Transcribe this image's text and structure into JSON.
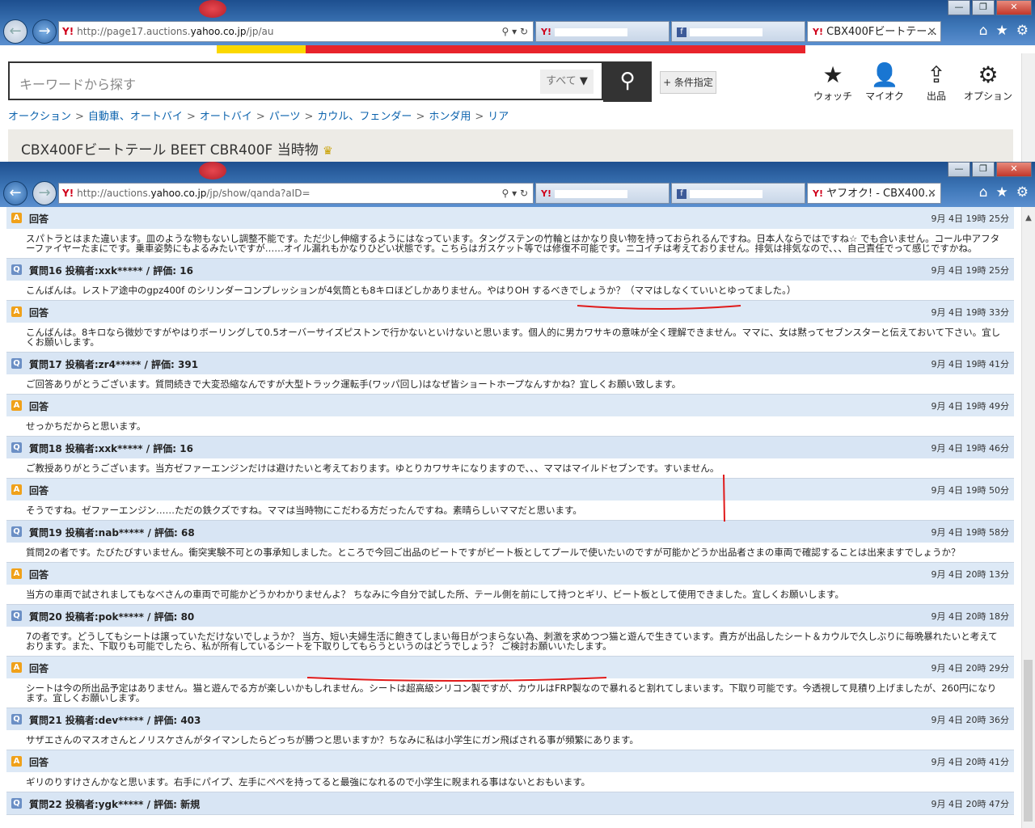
{
  "window1": {
    "url_host": "http://page17.auctions.",
    "url_domain": "yahoo.co.jp",
    "url_path": "/jp/au",
    "tab_active_title": "CBX400Fビートテー..."
  },
  "window2": {
    "url_host": "http://auctions.",
    "url_domain": "yahoo.co.jp",
    "url_path": "/jp/show/qanda?aID=",
    "tab_active_title": "ヤフオク! - CBX400..."
  },
  "search": {
    "placeholder": "キーワードから探す",
    "category": "すべて",
    "condition_button": "+ 条件指定"
  },
  "tools": [
    {
      "label": "ウォッチ",
      "icon": "star-icon"
    },
    {
      "label": "マイオク",
      "icon": "person-icon"
    },
    {
      "label": "出品",
      "icon": "upload-icon"
    },
    {
      "label": "オプション",
      "icon": "gear-icon"
    }
  ],
  "breadcrumb": [
    "オークション",
    "自動車、オートバイ",
    "オートバイ",
    "パーツ",
    "カウル、フェンダー",
    "ホンダ用",
    "リア"
  ],
  "item_title": "CBX400Fビートテール BEET CBR400F 当時物",
  "qa": [
    {
      "type": "a",
      "label": "回答",
      "time": "9月 4日 19時 25分",
      "text": "スパトラとはまた違います。皿のような物もないし調整不能です。ただ少し伸縮するようにはなっています。タングステンの竹輪とはかなり良い物を持っておられるんですね。日本人ならではですね☆ でも合いません。コール中アフターファイヤーたまにです。乗車姿勢にもよるみたいですが……オイル漏れもかなりひどい状態です。こちらはガスケット等では修復不可能です。ニコイチは考えておりません。排気は排気なので、、、自己責任でって感じですかね。"
    },
    {
      "type": "q",
      "label": "質問16 投稿者:xxk***** / 評価: 16",
      "time": "9月 4日 19時 25分",
      "text": "こんばんは。レストア途中のgpz400f のシリンダーコンプレッションが4気筒とも8キロほどしかありません。やはりOH するべきでしょうか？（ママはしなくていいとゆってました。）"
    },
    {
      "type": "a",
      "label": "回答",
      "time": "9月 4日 19時 33分",
      "text": "こんばんは。8キロなら微妙ですがやはりボーリングして0.5オーバーサイズピストンで行かないといけないと思います。個人的に男カワサキの意味が全く理解できません。ママに、女は黙ってセブンスターと伝えておいて下さい。宜しくお願いします。"
    },
    {
      "type": "q",
      "label": "質問17 投稿者:zr4***** / 評価: 391",
      "time": "9月 4日 19時 41分",
      "text": "ご回答ありがとうございます。質問続きで大変恐縮なんですが大型トラック運転手(ワッパ回し)はなぜ皆ショートホープなんすかね？宜しくお願い致します。"
    },
    {
      "type": "a",
      "label": "回答",
      "time": "9月 4日 19時 49分",
      "text": "せっかちだからと思います。"
    },
    {
      "type": "q",
      "label": "質問18 投稿者:xxk***** / 評価: 16",
      "time": "9月 4日 19時 46分",
      "text": "ご教授ありがとうございます。当方ゼファーエンジンだけは避けたいと考えております。ゆとりカワサキになりますので、、、ママはマイルドセブンです。すいません。"
    },
    {
      "type": "a",
      "label": "回答",
      "time": "9月 4日 19時 50分",
      "text": "そうですね。ゼファーエンジン……ただの鉄クズですね。ママは当時物にこだわる方だったんですね。素晴らしいママだと思います。"
    },
    {
      "type": "q",
      "label": "質問19 投稿者:nab***** / 評価: 68",
      "time": "9月 4日 19時 58分",
      "text": "質問2の者です。たびたびすいません。衝突実験不可との事承知しました。ところで今回ご出品のビートですがビート板としてプールで使いたいのですが可能かどうか出品者さまの車両で確認することは出来ますでしょうか？"
    },
    {
      "type": "a",
      "label": "回答",
      "time": "9月 4日 20時 13分",
      "text": "当方の車両で試されましてもなべさんの車両で可能かどうかわかりませんよ？ ちなみに今自分で試した所、テール側を前にして持つとギリ、ビート板として使用できました。宜しくお願いします。"
    },
    {
      "type": "q",
      "label": "質問20 投稿者:pok***** / 評価: 80",
      "time": "9月 4日 20時 18分",
      "text": "7の者です。どうしてもシートは譲っていただけないでしょうか？ 当方、短い夫婦生活に飽きてしまい毎日がつまらない為、刺激を求めつつ猫と遊んで生きています。貴方が出品したシート＆カウルで久しぶりに毎晩暴れたいと考えております。また、下取りも可能でしたら、私が所有しているシートを下取りしてもらうというのはどうでしょう？ ご検討お願いいたします。"
    },
    {
      "type": "a",
      "label": "回答",
      "time": "9月 4日 20時 29分",
      "text": "シートは今の所出品予定はありません。猫と遊んでる方が楽しいかもしれません。シートは超高級シリコン製ですが、カウルはFRP製なので暴れると割れてしまいます。下取り可能です。今透視して見積り上げましたが、260円になります。宜しくお願いします。"
    },
    {
      "type": "q",
      "label": "質問21 投稿者:dev***** / 評価: 403",
      "time": "9月 4日 20時 36分",
      "text": "サザエさんのマスオさんとノリスケさんがタイマンしたらどっちが勝つと思いますか？ちなみに私は小学生にガン飛ばされる事が頻繁にあります。"
    },
    {
      "type": "a",
      "label": "回答",
      "time": "9月 4日 20時 41分",
      "text": "ギリのりすけさんかなと思います。右手にパイプ、左手にペペを持ってると最強になれるので小学生に睨まれる事はないとおもいます。"
    },
    {
      "type": "q",
      "label": "質問22 投稿者:ygk***** / 評価: 新規",
      "time": "9月 4日 20時 47分",
      "text": ""
    }
  ]
}
